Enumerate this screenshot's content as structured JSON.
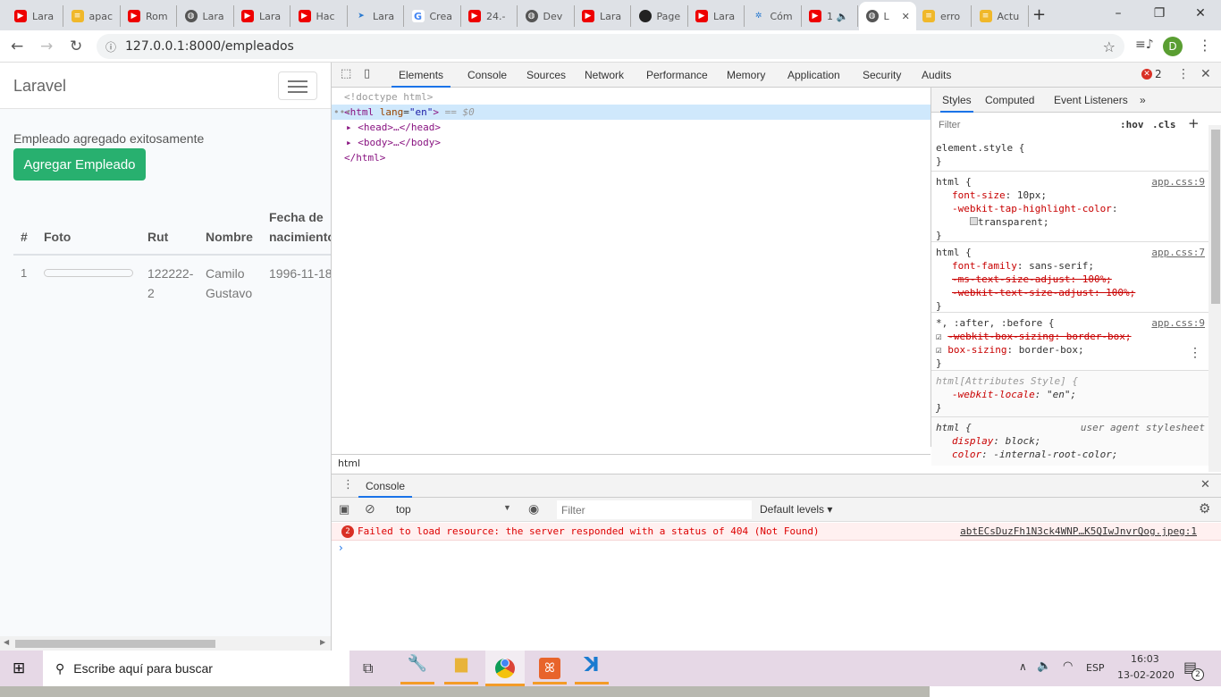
{
  "browser": {
    "tabs": [
      {
        "title": "Lara",
        "icon": "youtube-icon"
      },
      {
        "title": "apac",
        "icon": "stackoverflow-icon"
      },
      {
        "title": "Rom",
        "icon": "youtube-icon"
      },
      {
        "title": "Lara",
        "icon": "globe-icon"
      },
      {
        "title": "Lara",
        "icon": "youtube-icon"
      },
      {
        "title": "Hac",
        "icon": "youtube-icon"
      },
      {
        "title": "Lara",
        "icon": "plane-icon"
      },
      {
        "title": "Crea",
        "icon": "google-icon"
      },
      {
        "title": "24.-",
        "icon": "youtube-icon"
      },
      {
        "title": "Dev",
        "icon": "globe-icon"
      },
      {
        "title": "Lara",
        "icon": "youtube-icon"
      },
      {
        "title": "Page",
        "icon": "github-icon"
      },
      {
        "title": "Lara",
        "icon": "youtube-icon"
      },
      {
        "title": "Cóm",
        "icon": "star-logo-icon"
      },
      {
        "title": "1 🔈",
        "icon": "youtube-icon"
      },
      {
        "title": "L",
        "icon": "globe-icon",
        "active": true
      },
      {
        "title": "erro",
        "icon": "stackoverflow-icon"
      },
      {
        "title": "Actu",
        "icon": "stackoverflow-icon"
      }
    ],
    "url": "127.0.0.1:8000/empleados",
    "profile_initial": "D"
  },
  "page": {
    "brand": "Laravel",
    "message": "Empleado agregado exitosamente",
    "add_button": "Agregar Empleado",
    "table": {
      "headers": [
        "#",
        "Foto",
        "Rut",
        "Nombre",
        "Fecha de nacimiento"
      ],
      "rows": [
        {
          "id": "1",
          "rut": "122222-2",
          "nombre": "Camilo Gustavo",
          "fecha": "1996-11-18"
        }
      ]
    }
  },
  "devtools": {
    "tabs": [
      "Elements",
      "Console",
      "Sources",
      "Network",
      "Performance",
      "Memory",
      "Application",
      "Security",
      "Audits"
    ],
    "error_count": "2",
    "dom": {
      "doctype": "<!doctype html>",
      "html_open": "<html",
      "lang_attr": "lang",
      "lang_val": "\"en\"",
      "html_close_bracket": ">",
      "selected_marker": "== $0",
      "head": "<head>…</head>",
      "body": "<body>…</body>",
      "html_end": "</html>"
    },
    "breadcrumb": "html",
    "styles_tabs": [
      "Styles",
      "Computed",
      "Event Listeners"
    ],
    "filter_placeholder": "Filter",
    "hov": ":hov",
    "cls": ".cls",
    "rules": {
      "r0_sel": "element.style {",
      "r1_sel": "html {",
      "r1_src": "app.css:9",
      "r1_p1": "font-size",
      "r1_v1": "10px;",
      "r1_p2": "-webkit-tap-highlight-color",
      "r1_v2": "transparent;",
      "r2_sel": "html {",
      "r2_src": "app.css:7",
      "r2_p1": "font-family",
      "r2_v1": "sans-serif;",
      "r2_s1": "-ms-text-size-adjust: 100%;",
      "r2_s2": "-webkit-text-size-adjust: 100%;",
      "r3_sel": "*, :after, :before {",
      "r3_src": "app.css:9",
      "r3_s1": "-webkit-box-sizing: border-box;",
      "r3_p1": "box-sizing",
      "r3_v1": "border-box;",
      "r4_sel": "html[Attributes Style] {",
      "r4_p1": "-webkit-locale",
      "r4_v1": "\"en\";",
      "r5_sel": "html {",
      "r5_src": "user agent stylesheet",
      "r5_p1": "display",
      "r5_v1": "block;",
      "r5_p2": "color",
      "r5_v2": "-internal-root-color;"
    },
    "console": {
      "tab": "Console",
      "context": "top",
      "filter_placeholder": "Filter",
      "levels": "Default levels ▾",
      "error_badge": "2",
      "error_text": "Failed to load resource: the server responded with a status of 404 (Not Found)",
      "error_source": "abtECsDuzFh1N3ck4WNP…K5QIwJnvrQog.jpeg:1"
    }
  },
  "taskbar": {
    "search_placeholder": "Escribe aquí para buscar",
    "lang": "ESP",
    "time": "16:03",
    "date": "13-02-2020",
    "notifications": "2"
  }
}
